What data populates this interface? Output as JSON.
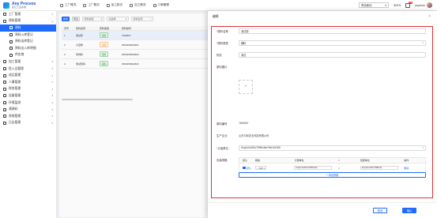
{
  "brand": {
    "title": "Any Process",
    "subtitle": "任亿工业系统"
  },
  "topnav": [
    {
      "label": "工厂概况",
      "icon": "factory-icon"
    },
    {
      "label": "工厂概况",
      "icon": "home-icon"
    },
    {
      "label": "加工批次",
      "icon": "batch-icon"
    },
    {
      "label": "加工概况",
      "icon": "process-icon"
    },
    {
      "label": "订单管理",
      "icon": "order-icon"
    }
  ],
  "header": {
    "org_select": "青岛新化",
    "lang": "中/EN",
    "badge": "12",
    "username": "anyform"
  },
  "sidebar": [
    {
      "label": "工厂管理",
      "type": "group"
    },
    {
      "label": "原料管理",
      "type": "group"
    },
    {
      "label": "原料",
      "type": "sub",
      "active": true
    },
    {
      "label": "原料入库登记",
      "type": "sub"
    },
    {
      "label": "原料出库登记",
      "type": "sub"
    },
    {
      "label": "原料出入库明细",
      "type": "sub"
    },
    {
      "label": "供应商",
      "type": "sub"
    },
    {
      "label": "加工管理",
      "type": "group"
    },
    {
      "label": "投入品管理",
      "type": "group"
    },
    {
      "label": "成品管理",
      "type": "group"
    },
    {
      "label": "人事管理",
      "type": "group"
    },
    {
      "label": "财务管理",
      "type": "group"
    },
    {
      "label": "设备管理",
      "type": "group"
    },
    {
      "label": "环境监测",
      "type": "group"
    },
    {
      "label": "溯源码",
      "type": "group"
    },
    {
      "label": "系统管理",
      "type": "group"
    },
    {
      "label": "日志管理",
      "type": "group"
    }
  ],
  "list": {
    "add_label": "新增",
    "export_label": "导出",
    "filter1": "原料类型",
    "filter2": "请选择",
    "filter3": "原料名称",
    "columns": [
      "序号",
      "原料名称",
      "原料类型",
      "原料编号"
    ],
    "rows": [
      {
        "idx": "1",
        "name": "测试原",
        "type": "辅料",
        "type_color": "green",
        "code": "7649657"
      },
      {
        "idx": "2",
        "name": "大豆粉",
        "type": "主料",
        "type_color": "orange",
        "code": "2503250602601"
      },
      {
        "idx": "3",
        "name": "鸡饲料",
        "type": "辅料",
        "type_color": "green",
        "code": "2503250602602"
      },
      {
        "idx": "4",
        "name": "测试原料",
        "type": "辅料",
        "type_color": "green",
        "code": "2503250602603"
      }
    ]
  },
  "drawer": {
    "title": "编辑",
    "fields": {
      "name_label": "原料名称",
      "name_value": "测试原",
      "type_label": "原料类型",
      "type_value": "辅料",
      "alias_label": "别名",
      "alias_value": "测试",
      "image_label": "原料图片",
      "code_label": "原料编号",
      "code_value": "7649657",
      "maker_label": "生产企业",
      "maker_value": "山东中和农业科技有限公司",
      "unit_label": "计量单位",
      "unit_value": "Kuq1x1ci0f1c7f99fc4eb7bfc1b1266",
      "spec_label": "包装规格"
    },
    "unit_table": {
      "columns": [
        "默认",
        "规格",
        "计量单位",
        "=",
        "包装单位",
        "操作"
      ],
      "row": {
        "default": "默认",
        "qty": "100",
        "unit": "Kuq1x1ci0f1c7f99fc4eb...",
        "eq": "=",
        "pack": "Kuq1x1ci0f1c7f99fc4e...",
        "op": "删除"
      }
    },
    "add_spec_label": "添加规格",
    "cancel_label": "取消",
    "ok_label": "确认"
  }
}
